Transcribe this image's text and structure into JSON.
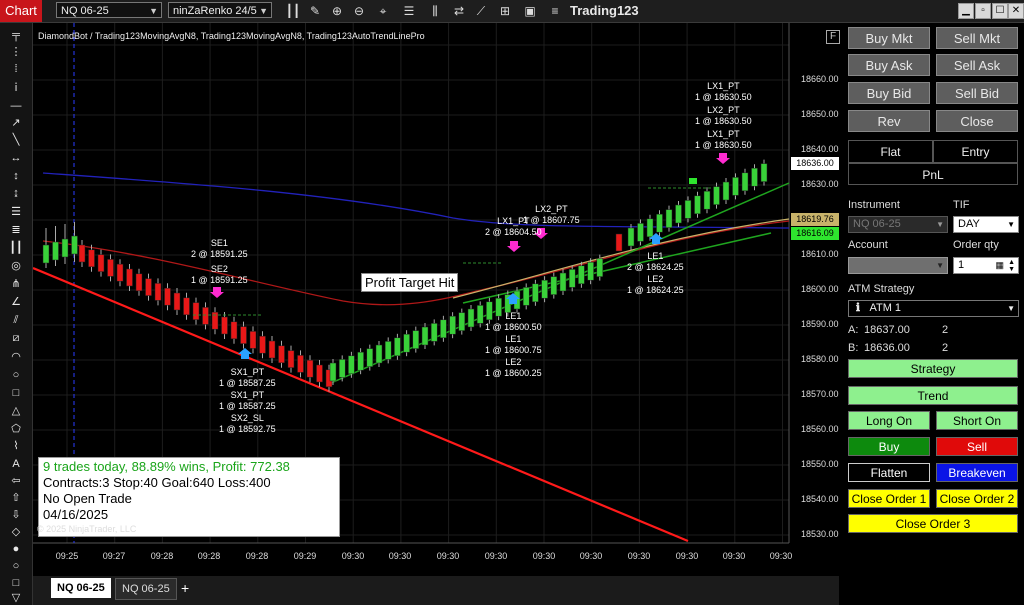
{
  "toolbar": {
    "chart_tab": "Chart",
    "instrument": "NQ 06-25",
    "bar_type": "ninZaRenko 24/5",
    "app_title": "Trading123"
  },
  "chart": {
    "header": "DiamondBot / Trading123MovingAvgN8, Trading123MovingAvgN8, Trading123AutoTrendLinePro",
    "f_label": "F",
    "copyright": "© 2025 NinjaTrader, LLC",
    "profit_target_label": "Profit Target Hit",
    "stats": {
      "line1": "9 trades today, 88.89% wins, Profit: 772.38",
      "line2": "Contracts:3 Stop:40 Goal:640 Loss:400",
      "line3": "No Open Trade",
      "line4": "04/16/2025"
    },
    "price_axis": [
      "18660.00",
      "18650.00",
      "18640.00",
      "18630.00",
      "18610.00",
      "18600.00",
      "18590.00",
      "18580.00",
      "18570.00",
      "18560.00",
      "18550.00",
      "18540.00",
      "18530.00"
    ],
    "price_tags": [
      {
        "label": "18636.00",
        "bg": "#ffffff",
        "fg": "#000000"
      },
      {
        "label": "18619.76",
        "bg": "#c8b36a",
        "fg": "#000000"
      },
      {
        "label": "18616.09",
        "bg": "#2ee52e",
        "fg": "#000000"
      }
    ],
    "time_axis": [
      "09:25",
      "09:27",
      "09:28",
      "09:28",
      "09:28",
      "09:29",
      "09:30",
      "09:30",
      "09:30",
      "09:30",
      "09:30",
      "09:30",
      "09:30",
      "09:30",
      "09:30",
      "09:30"
    ],
    "signals": [
      {
        "id": "se1",
        "title": "SE1",
        "detail": "2 @ 18591.25"
      },
      {
        "id": "se2",
        "title": "SE2",
        "detail": "1 @ 18591.25"
      },
      {
        "id": "sx1a",
        "title": "SX1_PT",
        "detail": "1 @ 18587.25"
      },
      {
        "id": "sx1b",
        "title": "SX1_PT",
        "detail": "1 @ 18587.25"
      },
      {
        "id": "sx2",
        "title": "SX2_SL",
        "detail": "1 @ 18592.75"
      },
      {
        "id": "lx1",
        "title": "LX1_PT",
        "detail": "2 @ 18604.50"
      },
      {
        "id": "lx2",
        "title": "LX2_PT",
        "detail": "1 @ 18607.75"
      },
      {
        "id": "le1a",
        "title": "LE1",
        "detail": "1 @ 18600.50"
      },
      {
        "id": "le1b",
        "title": "LE1",
        "detail": "1 @ 18600.75"
      },
      {
        "id": "le2a",
        "title": "LE2",
        "detail": "1 @ 18600.25"
      },
      {
        "id": "le1c",
        "title": "LE1",
        "detail": "2 @ 18624.25"
      },
      {
        "id": "le2b",
        "title": "LE2",
        "detail": "1 @ 18624.25"
      },
      {
        "id": "lx1pa",
        "title": "LX1_PT",
        "detail": "1 @ 18630.50"
      },
      {
        "id": "lx2p",
        "title": "LX2_PT",
        "detail": "1 @ 18630.50"
      },
      {
        "id": "lx1pb",
        "title": "LX1_PT",
        "detail": "1 @ 18630.50"
      }
    ]
  },
  "tabs": {
    "active": "NQ 06-25",
    "second": "NQ 06-25",
    "add": "+"
  },
  "panel": {
    "buy_mkt": "Buy Mkt",
    "sell_mkt": "Sell Mkt",
    "buy_ask": "Buy Ask",
    "sell_ask": "Sell Ask",
    "buy_bid": "Buy Bid",
    "sell_bid": "Sell Bid",
    "rev": "Rev",
    "close": "Close",
    "flat": "Flat",
    "entry": "Entry",
    "pnl": "PnL",
    "instrument_label": "Instrument",
    "instrument_value": "NQ 06-25",
    "tif_label": "TIF",
    "tif_value": "DAY",
    "account_label": "Account",
    "order_qty_label": "Order qty",
    "order_qty_value": "1",
    "atm_label": "ATM Strategy",
    "atm_value": "ATM 1",
    "ask_label": "A:",
    "ask_price": "18637.00",
    "ask_qty": "2",
    "bid_label": "B:",
    "bid_price": "18636.00",
    "bid_qty": "2",
    "strategy": "Strategy",
    "trend": "Trend",
    "long_on": "Long On",
    "short_on": "Short On",
    "buy": "Buy",
    "sell": "Sell",
    "flatten": "Flatten",
    "breakeven": "Breakeven",
    "close_order_1": "Close Order 1",
    "close_order_2": "Close Order 2",
    "close_order_3": "Close Order 3"
  },
  "colors": {
    "up_candle": "#39d139",
    "down_candle": "#e81818",
    "green_button": "#8ef08e",
    "buy_button": "#0d8a0d",
    "sell_button": "#e00a0a",
    "breakeven_button": "#0a14e6",
    "close_order_button": "#ffff00"
  }
}
